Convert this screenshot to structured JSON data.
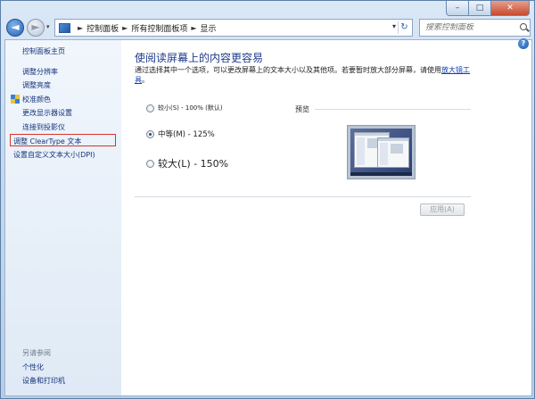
{
  "window": {
    "controls": {
      "minimize": "–",
      "maximize": "□",
      "close": "✕"
    }
  },
  "nav": {
    "back_glyph": "◄",
    "forward_glyph": "►",
    "recent_glyph": "▾",
    "breadcrumbs": [
      "控制面板",
      "所有控制面板项",
      "显示"
    ],
    "separator": "►",
    "dropdown_glyph": "▾",
    "refresh_glyph": "↻",
    "search_placeholder": "搜索控制面板"
  },
  "help_glyph": "?",
  "sidebar": {
    "items": [
      {
        "label": "控制面板主页"
      },
      {
        "label": "调整分辨率"
      },
      {
        "label": "调整亮度"
      },
      {
        "label": "校准颜色"
      },
      {
        "label": "更改显示器设置"
      },
      {
        "label": "连接到投影仪"
      },
      {
        "label": "调整 ClearType 文本"
      },
      {
        "label": "设置自定义文本大小(DPI)"
      }
    ],
    "see_also_heading": "另请参阅",
    "see_also": [
      {
        "label": "个性化"
      },
      {
        "label": "设备和打印机"
      }
    ],
    "highlight_color": "#d8332d"
  },
  "main": {
    "title": "使阅读屏幕上的内容更容易",
    "description": "通过选择其中一个选项，可以更改屏幕上的文本大小以及其他项。若要暂时放大部分屏幕，请使用",
    "description_link": "放大镜工具",
    "description_end": "。",
    "options": [
      {
        "label": "较小(S) - 100% (默认)",
        "checked": false
      },
      {
        "label": "中等(M) - 125%",
        "checked": true
      },
      {
        "label": "较大(L) - 150%",
        "checked": false
      }
    ],
    "preview_label": "预览",
    "apply_label": "应用(A)"
  },
  "colors": {
    "title_text": "#1e3b8a",
    "link": "#15327a",
    "accent": "#2760b5"
  }
}
